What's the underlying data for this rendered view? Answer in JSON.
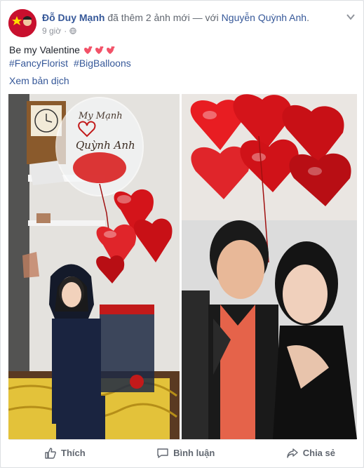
{
  "post": {
    "author": "Đỗ Duy Mạnh",
    "action_text": "đã thêm 2 ảnh mới — với",
    "tagged": "Nguyễn Quỳnh Anh",
    "tagged_suffix": ".",
    "time": "9 giờ",
    "time_sep": "·",
    "audience_icon": "globe-icon",
    "menu_icon": "chevron-down-icon",
    "text_line1": "Be my Valentine",
    "hashtags": [
      "#FancyFlorist",
      "#BigBalloons"
    ],
    "see_translation": "Xem bản dịch"
  },
  "photos": {
    "left": {
      "balloon_text_top": "My Mạnh",
      "balloon_text_bottom": "Quỳnh Anh"
    }
  },
  "actions": {
    "like_label": "Thích",
    "comment_label": "Bình luận",
    "share_label": "Chia sẻ"
  },
  "colors": {
    "link": "#365899",
    "secondary": "#90949c",
    "balloon_red": "#d4141a"
  }
}
